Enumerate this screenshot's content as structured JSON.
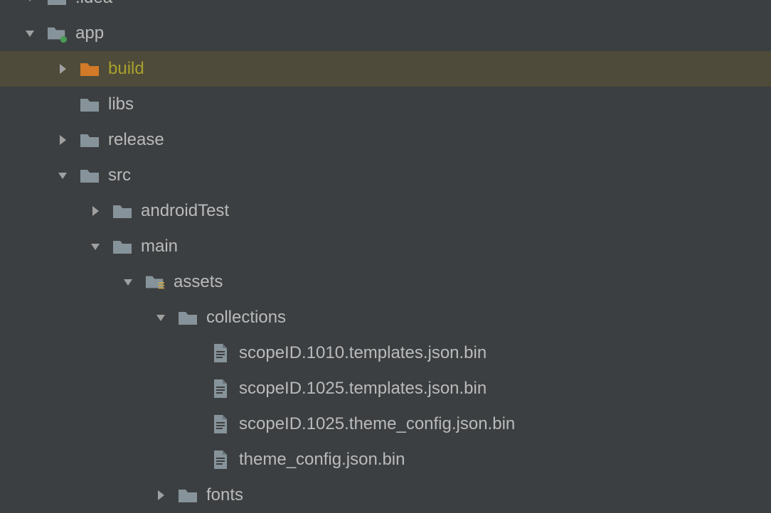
{
  "colors": {
    "bg": "#3c3f41",
    "text": "#bababa",
    "selectedBg": "#4f4b3a",
    "selectedText": "#a8a12c",
    "folderGray": "#87939a",
    "folderOrange": "#d27a28",
    "fileIcon": "#87939a",
    "arrow": "#a0a0a0",
    "moduleDot": "#499c54"
  },
  "tree": [
    {
      "level": 0,
      "expanded": true,
      "icon": "folder",
      "label": ".idea",
      "partial": true
    },
    {
      "level": 0,
      "expanded": true,
      "icon": "module-folder",
      "label": "app"
    },
    {
      "level": 1,
      "expanded": false,
      "icon": "folder-orange",
      "label": "build",
      "selected": true
    },
    {
      "level": 1,
      "expanded": null,
      "icon": "folder",
      "label": "libs"
    },
    {
      "level": 1,
      "expanded": false,
      "icon": "folder",
      "label": "release"
    },
    {
      "level": 1,
      "expanded": true,
      "icon": "folder",
      "label": "src"
    },
    {
      "level": 2,
      "expanded": false,
      "icon": "folder",
      "label": "androidTest"
    },
    {
      "level": 2,
      "expanded": true,
      "icon": "folder",
      "label": "main"
    },
    {
      "level": 3,
      "expanded": true,
      "icon": "assets-folder",
      "label": "assets"
    },
    {
      "level": 4,
      "expanded": true,
      "icon": "folder",
      "label": "collections"
    },
    {
      "level": 5,
      "expanded": null,
      "icon": "file",
      "label": "scopeID.1010.templates.json.bin"
    },
    {
      "level": 5,
      "expanded": null,
      "icon": "file",
      "label": "scopeID.1025.templates.json.bin"
    },
    {
      "level": 5,
      "expanded": null,
      "icon": "file",
      "label": "scopeID.1025.theme_config.json.bin"
    },
    {
      "level": 5,
      "expanded": null,
      "icon": "file",
      "label": "theme_config.json.bin"
    },
    {
      "level": 4,
      "expanded": false,
      "icon": "folder",
      "label": "fonts"
    }
  ]
}
